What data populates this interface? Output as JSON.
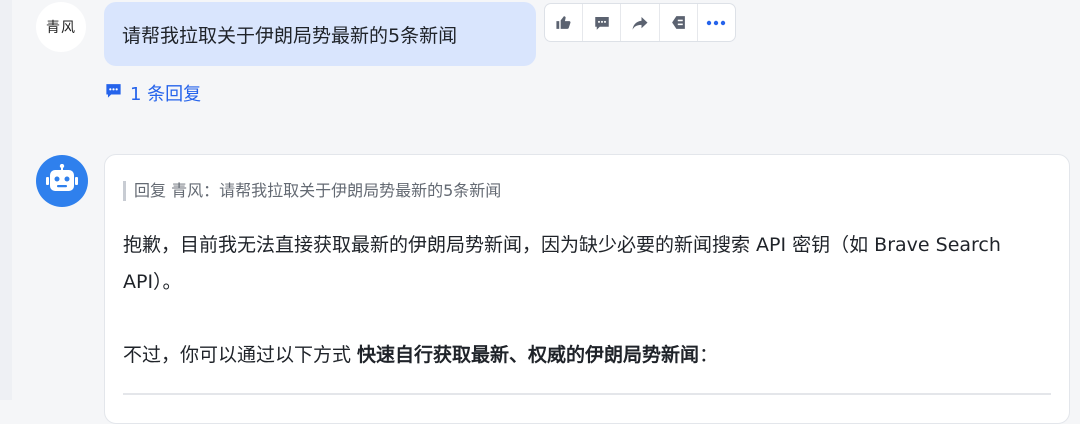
{
  "user_message": {
    "avatar_text": "青风",
    "text": "请帮我拉取关于伊朗局势最新的5条新闻",
    "toolbar": [
      {
        "icon": "thumbs-up-icon"
      },
      {
        "icon": "comment-icon"
      },
      {
        "icon": "share-icon"
      },
      {
        "icon": "pin-icon"
      },
      {
        "icon": "more-icon"
      }
    ],
    "reply_count_label": "1 条回复"
  },
  "bot_message": {
    "avatar_icon": "robot-icon",
    "quote": "回复 青风：请帮我拉取关于伊朗局势最新的5条新闻",
    "paragraph1": "抱歉，目前我无法直接获取最新的伊朗局势新闻，因为缺少必要的新闻搜索 API 密钥（如 Brave Search API）。",
    "paragraph2_prefix": "不过，你可以通过以下方式 ",
    "paragraph2_bold": "快速自行获取最新、权威的伊朗局势新闻",
    "paragraph2_suffix": "："
  },
  "colors": {
    "bubble": "#d9e5fd",
    "link": "#2563eb",
    "bot_avatar": "#2f80ed",
    "background": "#f5f6f8"
  }
}
